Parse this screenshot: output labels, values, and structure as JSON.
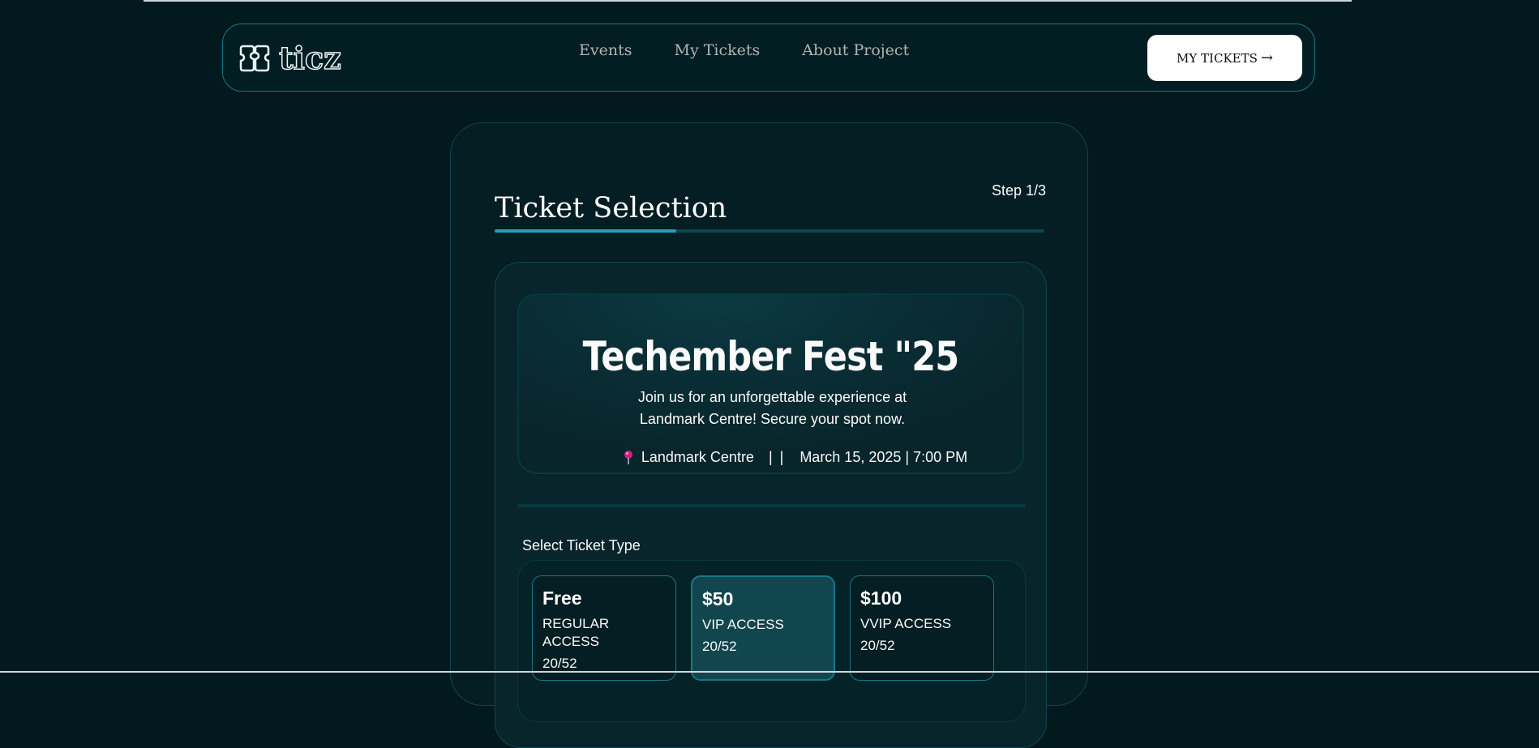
{
  "brand": {
    "name": "ticz",
    "logo_icon": "ticket-icon"
  },
  "nav": {
    "items": [
      {
        "label": "Events"
      },
      {
        "label": "My Tickets"
      },
      {
        "label": "About Project"
      }
    ]
  },
  "header_button": {
    "label": "MY TICKETS",
    "arrow": "→"
  },
  "step": {
    "title": "Ticket Selection",
    "label": "Step 1/3",
    "progress_fraction": 0.33
  },
  "event": {
    "title": "Techember Fest \"25",
    "description": "Join us for an unforgettable experience at Landmark Centre! Secure your spot now.",
    "location": "Landmark Centre",
    "separator": "| |",
    "datetime": "March 15, 2025 | 7:00 PM",
    "location_icon": "pin-icon"
  },
  "ticket_section": {
    "label": "Select Ticket Type",
    "selected_index": 1,
    "types": [
      {
        "price": "Free",
        "access": "REGULAR ACCESS",
        "availability": "20/52"
      },
      {
        "price": "$50",
        "access": "VIP ACCESS",
        "availability": "20/52"
      },
      {
        "price": "$100",
        "access": "VVIP ACCESS",
        "availability": "20/52"
      }
    ]
  },
  "colors": {
    "background": "#02191d",
    "accent": "#24a0b5",
    "border": "#197686",
    "selected_ticket": "#12464e"
  }
}
